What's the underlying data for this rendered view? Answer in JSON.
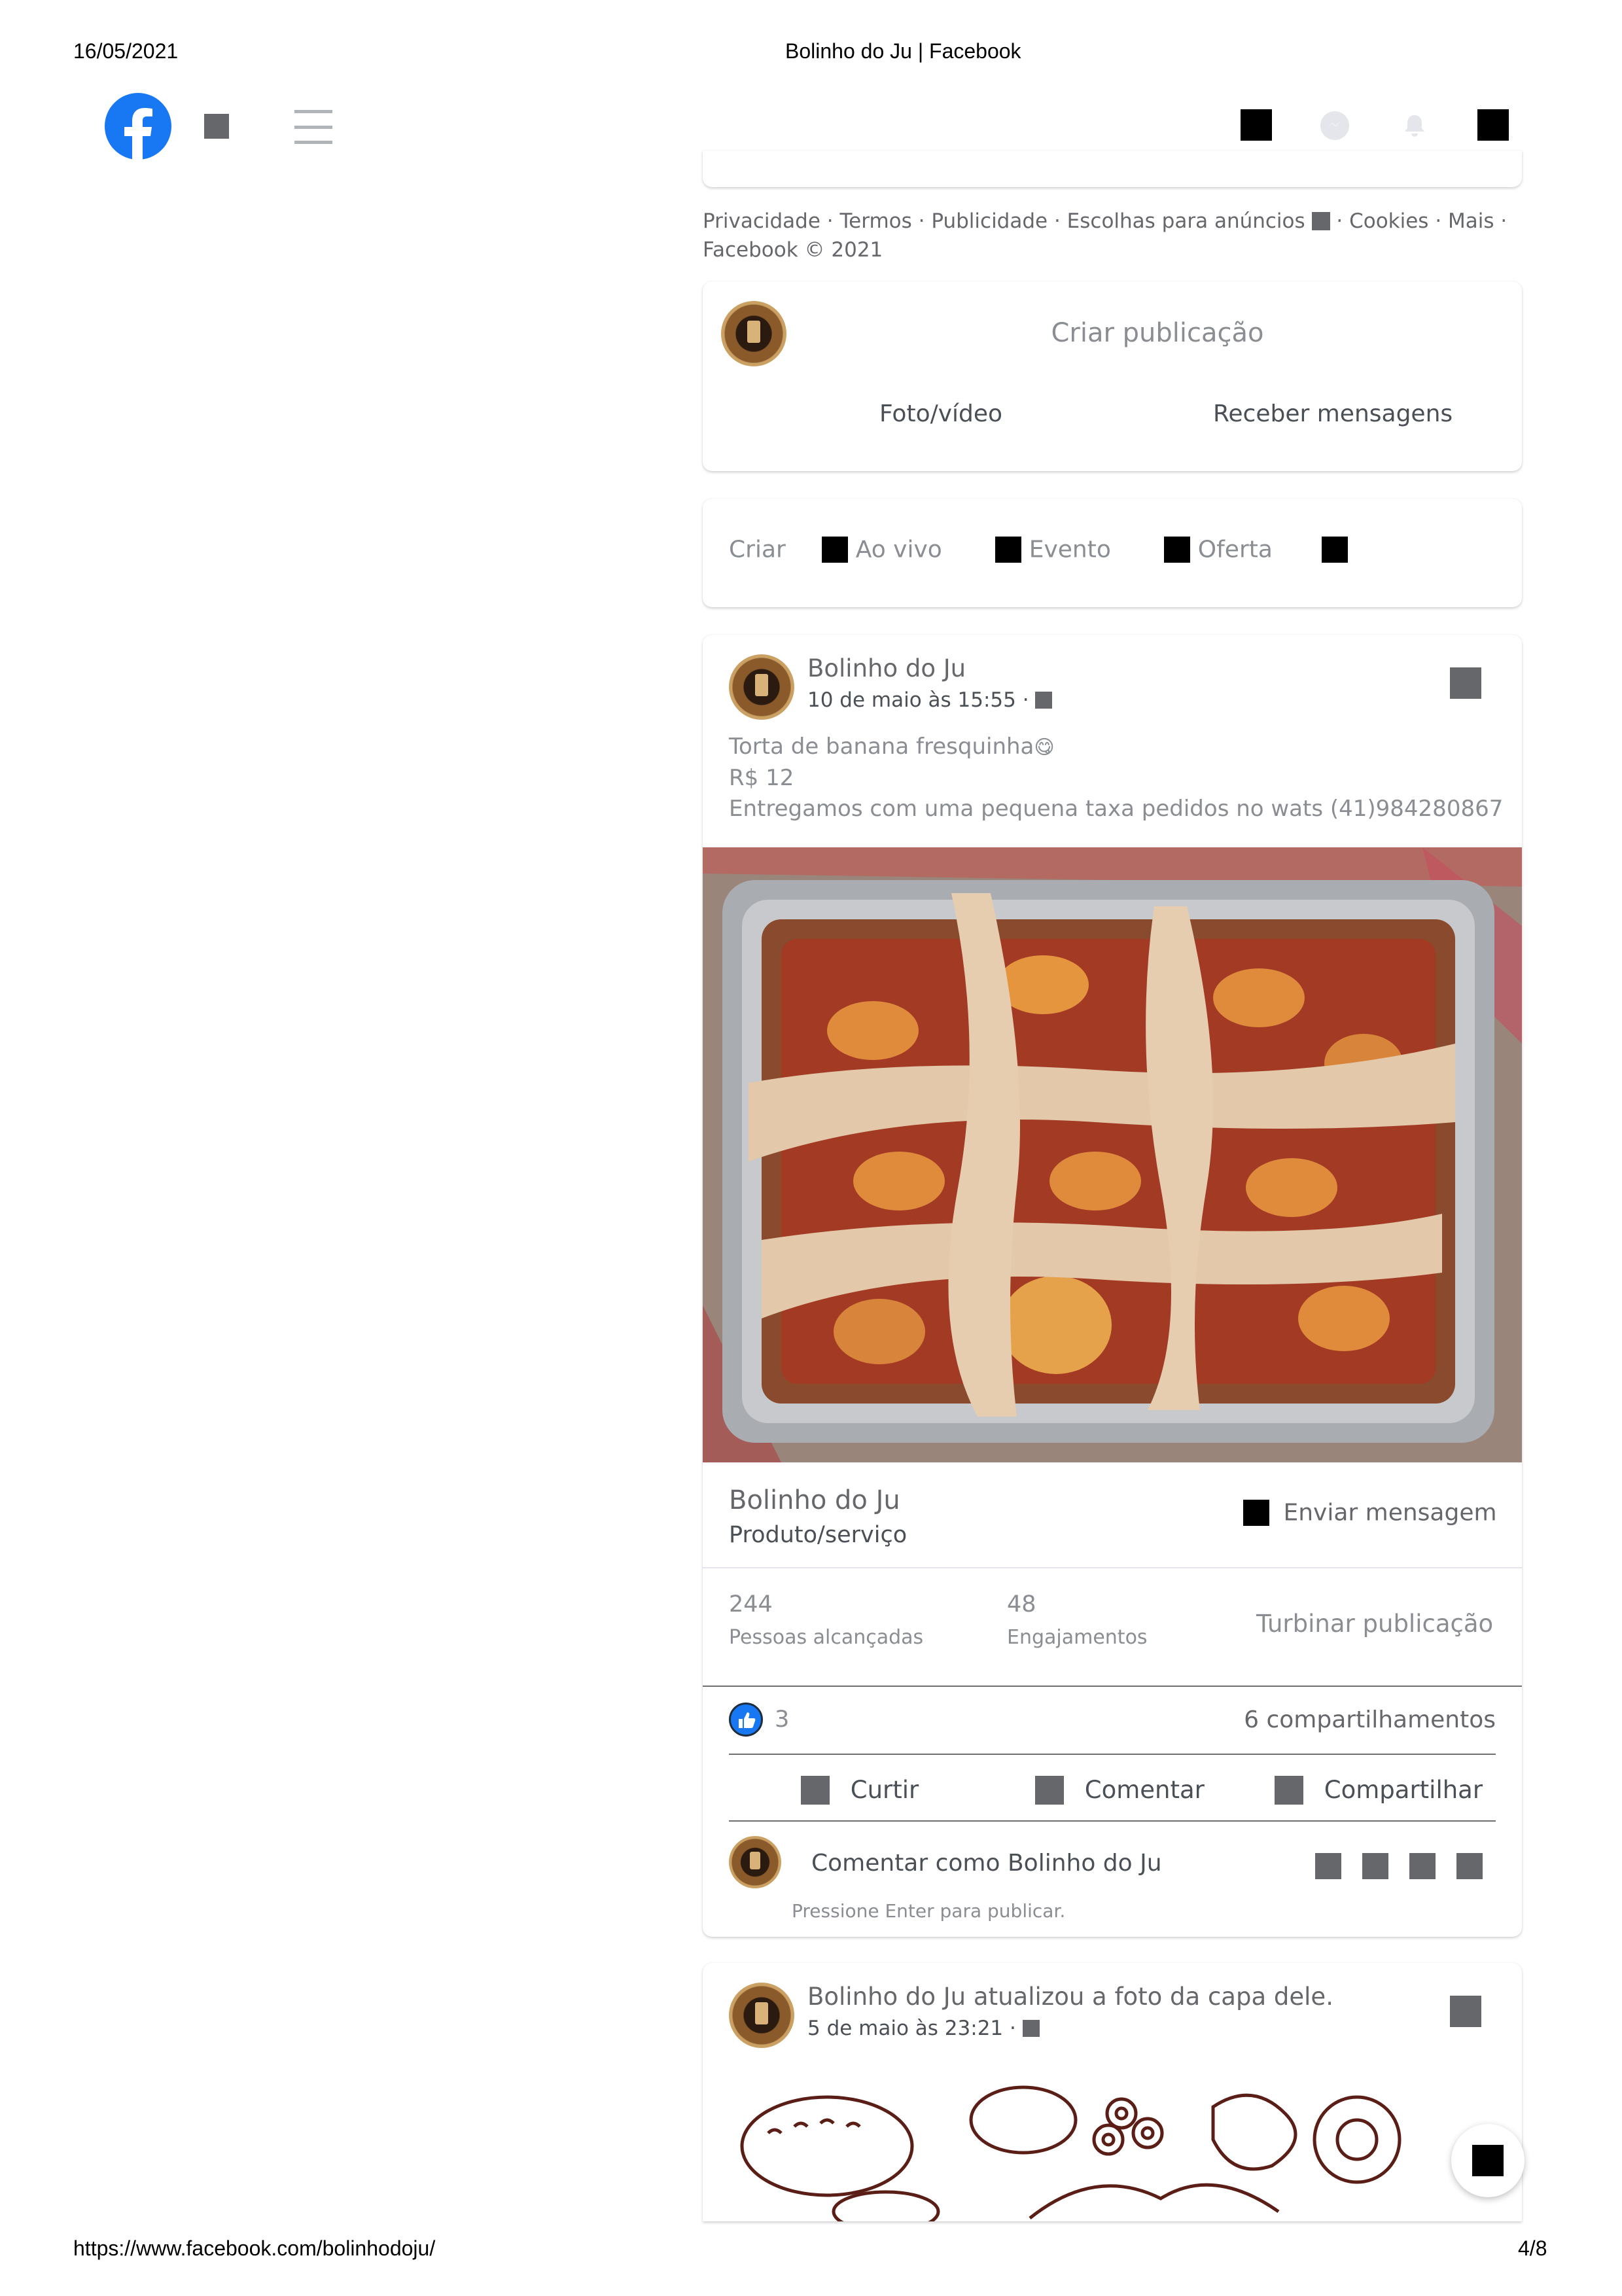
{
  "print_header": {
    "date": "16/05/2021",
    "title": "Bolinho do Ju | Facebook"
  },
  "print_footer": {
    "url": "https://www.facebook.com/bolinhodoju/",
    "page": "4/8"
  },
  "top_nav": {
    "logo_icon": "facebook-logo",
    "brand_color": "#1877f2",
    "menu_icon": "hamburger-menu-icon",
    "messenger_icon": "messenger-icon",
    "notifications_icon": "bell-icon"
  },
  "footer_links": {
    "privacy": "Privacidade",
    "terms": "Termos",
    "ads": "Publicidade",
    "ad_choices": "Escolhas para anúncios",
    "cookies": "Cookies",
    "more": "Mais",
    "copyright": "Facebook © 2021"
  },
  "composer": {
    "placeholder": "Criar publicação",
    "photo_video": "Foto/vídeo",
    "get_messages": "Receber mensagens"
  },
  "create_bar": {
    "label": "Criar",
    "live": "Ao vivo",
    "event": "Evento",
    "offer": "Oferta"
  },
  "post1": {
    "author": "Bolinho do Ju",
    "time": "10 de maio às 15:55 ·",
    "text_line1": "Torta de banana fresquinha",
    "emoji": "😋",
    "text_line2": "R$ 12",
    "text_line3": "Entregamos com uma pequena taxa pedidos no wats (41)984280867",
    "image_alt": "banana-pie-photo",
    "page_name": "Bolinho do Ju",
    "page_category": "Produto/serviço",
    "send_message": "Enviar mensagem",
    "reach_value": "244",
    "reach_label": "Pessoas alcançadas",
    "engagement_value": "48",
    "engagement_label": "Engajamentos",
    "boost": "Turbinar publicação",
    "reactions_count": "3",
    "shares": "6 compartilhamentos",
    "like": "Curtir",
    "comment": "Comentar",
    "share": "Compartilhar",
    "comment_placeholder": "Comentar como Bolinho do Ju",
    "enter_hint": "Pressione Enter para publicar."
  },
  "post2": {
    "author": "Bolinho do Ju",
    "action": "atualizou a foto da capa dele.",
    "time": "5 de maio às 23:21 ·"
  }
}
